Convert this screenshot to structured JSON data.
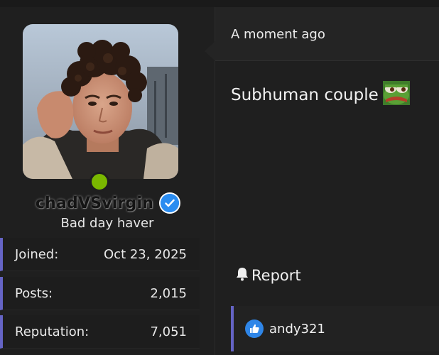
{
  "user": {
    "username": "chadVSvirgin",
    "title": "Bad day haver",
    "verified": true,
    "online": true,
    "online_color": "#7ab800",
    "verified_color": "#2a8cf0",
    "stats": [
      {
        "label": "Joined:",
        "value": "Oct 23, 2025"
      },
      {
        "label": "Posts:",
        "value": "2,015"
      },
      {
        "label": "Reputation:",
        "value": "7,051"
      }
    ]
  },
  "post": {
    "time": "A moment ago",
    "message": "Subhuman couple",
    "emoji": "pepe-frog-emoji",
    "report_label": "Report",
    "report_icon": "bell-icon",
    "likes": {
      "icon": "thumbs-up-icon",
      "users": [
        "andy321"
      ]
    }
  },
  "colors": {
    "accent": "#6564c5",
    "background": "#1f1f1f",
    "like_blue": "#2f86e8"
  }
}
